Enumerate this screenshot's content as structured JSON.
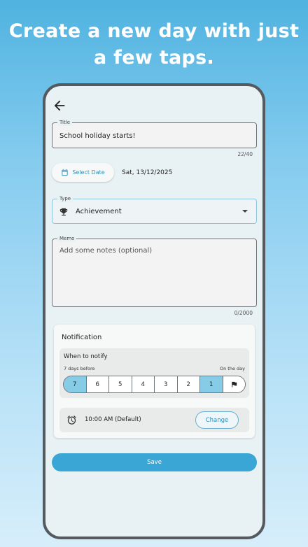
{
  "headline": {
    "line1": "Create a new day with just",
    "line2": "a few taps."
  },
  "form": {
    "back_icon": "arrow-left-icon",
    "title": {
      "label": "Title",
      "value": "School holiday starts!",
      "counter": "22/40"
    },
    "date": {
      "button_label": "Select Date",
      "button_icon": "calendar-icon",
      "value": "Sat, 13/12/2025"
    },
    "type": {
      "label": "Type",
      "value": "Achievement",
      "icon": "trophy-icon"
    },
    "memo": {
      "label": "Memo",
      "placeholder": "Add some notes (optional)",
      "counter": "0/2000"
    },
    "notification": {
      "title": "Notification",
      "when_title": "When to notify",
      "left_caption": "7 days before",
      "right_caption": "On the day",
      "segments": [
        "7",
        "6",
        "5",
        "4",
        "3",
        "2",
        "1",
        "flag"
      ],
      "selected": [
        "7",
        "1"
      ],
      "time": {
        "icon": "alarm-clock-icon",
        "value": "10:00 AM (Default)",
        "change_label": "Change"
      }
    },
    "save_label": "Save"
  },
  "colors": {
    "accent": "#3aa6d6",
    "selected_segment": "#86cce7",
    "phone_frame": "#555a5e",
    "screen_bg": "#e8f1f4"
  }
}
